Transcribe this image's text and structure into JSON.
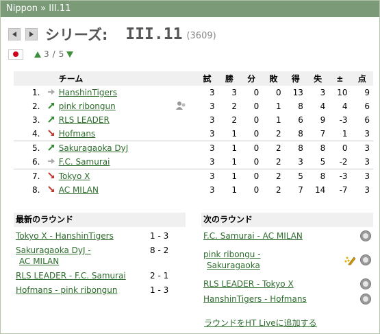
{
  "header": {
    "breadcrumb": "Nippon » III.11"
  },
  "title": {
    "label": "シリーズ:",
    "series": "III.11",
    "count": "(3609)"
  },
  "subnav": {
    "current": "3",
    "separator": "/",
    "total": "5"
  },
  "standings": {
    "headers": [
      "チーム",
      "試",
      "勝",
      "分",
      "敗",
      "得",
      "失",
      "±",
      "点"
    ],
    "rows": [
      {
        "pos": "1.",
        "trend": "same",
        "team": "HanshinTigers",
        "g": "3",
        "w": "3",
        "d": "0",
        "l": "0",
        "gf": "13",
        "ga": "3",
        "diff": "10",
        "pts": "9"
      },
      {
        "pos": "2.",
        "trend": "up",
        "team": "pink ribongun",
        "g": "3",
        "w": "2",
        "d": "0",
        "l": "1",
        "gf": "8",
        "ga": "4",
        "diff": "4",
        "pts": "6"
      },
      {
        "pos": "3.",
        "trend": "up",
        "team": "RLS LEADER",
        "g": "3",
        "w": "2",
        "d": "0",
        "l": "1",
        "gf": "6",
        "ga": "9",
        "diff": "-3",
        "pts": "6"
      },
      {
        "pos": "4.",
        "trend": "down",
        "team": "Hofmans",
        "g": "3",
        "w": "1",
        "d": "0",
        "l": "2",
        "gf": "8",
        "ga": "7",
        "diff": "1",
        "pts": "3"
      },
      {
        "pos": "5.",
        "trend": "up",
        "team": "Sakuragaoka DyJ",
        "g": "3",
        "w": "1",
        "d": "0",
        "l": "2",
        "gf": "8",
        "ga": "8",
        "diff": "0",
        "pts": "3"
      },
      {
        "pos": "6.",
        "trend": "same",
        "team": "F.C. Samurai",
        "g": "3",
        "w": "1",
        "d": "0",
        "l": "2",
        "gf": "3",
        "ga": "5",
        "diff": "-2",
        "pts": "3"
      },
      {
        "pos": "7.",
        "trend": "down",
        "team": "Tokyo X",
        "g": "3",
        "w": "1",
        "d": "0",
        "l": "2",
        "gf": "5",
        "ga": "8",
        "diff": "-3",
        "pts": "3"
      },
      {
        "pos": "8.",
        "trend": "down",
        "team": "AC MILAN",
        "g": "3",
        "w": "1",
        "d": "0",
        "l": "2",
        "gf": "7",
        "ga": "14",
        "diff": "-7",
        "pts": "3"
      }
    ]
  },
  "latest_round": {
    "title": "最新のラウンド",
    "matches": [
      {
        "line1": "Tokyo X - HanshinTigers",
        "line2": "",
        "score": "1 - 3"
      },
      {
        "line1": "Sakuragaoka DyJ -",
        "line2": "AC MILAN",
        "score": "8 - 2"
      },
      {
        "line1": "RLS LEADER - F.C. Samurai",
        "line2": "",
        "score": "2 - 1"
      },
      {
        "line1": "Hofmans - pink ribongun",
        "line2": "",
        "score": "1 - 3"
      }
    ]
  },
  "next_round": {
    "title": "次のラウンド",
    "matches": [
      {
        "line1": "F.C. Samurai - AC MILAN",
        "line2": ""
      },
      {
        "line1": "pink ribongu -",
        "line2": "Sakuragaoka"
      },
      {
        "line1": "RLS LEADER - Tokyo X",
        "line2": ""
      },
      {
        "line1": "HanshinTigers - Hofmans",
        "line2": ""
      }
    ],
    "add_link": "ラウンドをHT Liveに追加する"
  },
  "colors": {
    "header_bg": "#7a9a78",
    "link": "#2d6b2d",
    "trend_up": "#2e8b2e",
    "trend_down": "#c0392b",
    "trend_same": "#aaaaaa"
  }
}
